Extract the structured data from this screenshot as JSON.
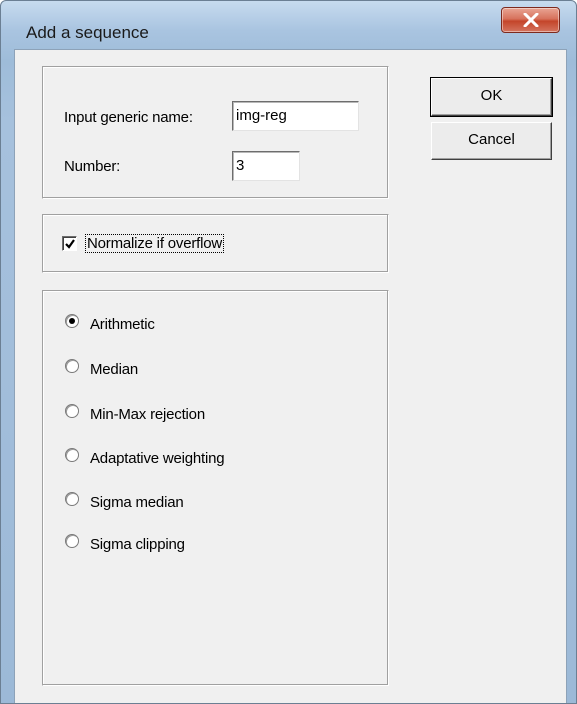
{
  "window": {
    "title": "Add a sequence"
  },
  "fields": {
    "generic_name_label": "Input generic name:",
    "generic_name_value": "img-reg",
    "number_label": "Number:",
    "number_value": "3"
  },
  "checkbox": {
    "normalize_label": "Normalize if overflow",
    "normalize_checked": true
  },
  "methods": {
    "selected": "Arithmetic",
    "options": [
      "Arithmetic",
      "Median",
      "Min-Max rejection",
      "Adaptative weighting",
      "Sigma median",
      "Sigma clipping"
    ]
  },
  "buttons": {
    "ok_label": "OK",
    "cancel_label": "Cancel"
  }
}
